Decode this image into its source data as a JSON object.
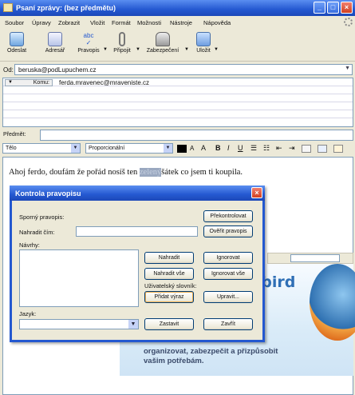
{
  "window": {
    "title": "Psaní zprávy: (bez předmětu)"
  },
  "menu": [
    "Soubor",
    "Úpravy",
    "Zobrazit",
    "Vložit",
    "Formát",
    "Možnosti",
    "Nástroje",
    "Nápověda"
  ],
  "toolbar": {
    "send": "Odeslat",
    "address_book": "Adresář",
    "spell": "Pravopis",
    "attach": "Připojit",
    "security": "Zabezpečení",
    "save": "Uložit",
    "spell_icon_text": "abc"
  },
  "from": {
    "label": "Od:",
    "value": "beruska@podLupuchem.cz"
  },
  "recipients": [
    {
      "type": "Komu:",
      "address": "ferda.mravenec@mraveniste.cz"
    }
  ],
  "subject": {
    "label": "Předmět:",
    "value": ""
  },
  "format": {
    "paragraph": "Tělo",
    "font": "Proporcionální",
    "smaller": "A",
    "larger": "A",
    "bold": "B",
    "italic": "I",
    "underline": "U"
  },
  "body": {
    "text_before": "Ahoj ferdo, doufám že pořád nosíš ten ",
    "misspelled": "zelený",
    "text_after": "šátek co jsem ti koupila."
  },
  "banner": {
    "word": "erbird",
    "text": "organizovat, zabezpečit a přizpůsobit vašim potřebám."
  },
  "spell_dialog": {
    "title": "Kontrola pravopisu",
    "misspelled_label": "Sporný pravopis:",
    "replace_label": "Nahradit čím:",
    "replace_value": "",
    "suggestions_label": "Návrhy:",
    "suggestions": [],
    "dictionary_label": "Uživatelský slovník:",
    "language_label": "Jazyk:",
    "language_value": "",
    "buttons": {
      "recheck": "Překontrolovat",
      "check_word": "Ověřit pravopis",
      "replace": "Nahradit",
      "ignore": "Ignorovat",
      "replace_all": "Nahradit vše",
      "ignore_all": "Ignorovat vše",
      "add_word": "Přidat výraz",
      "edit": "Upravit...",
      "stop": "Zastavit",
      "close": "Zavřít"
    }
  }
}
